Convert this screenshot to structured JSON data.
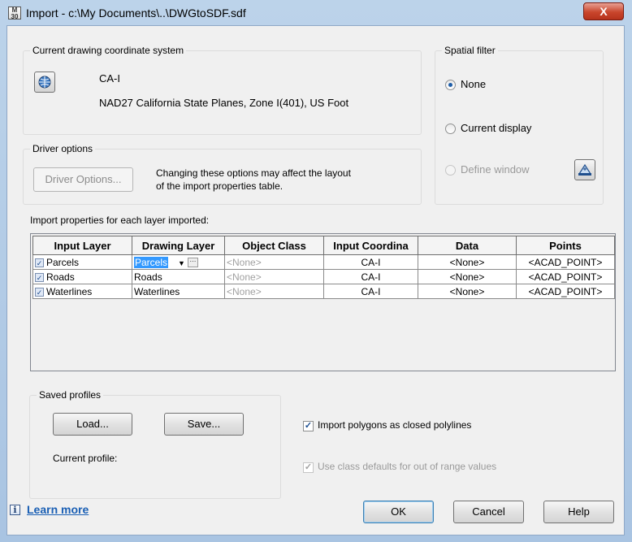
{
  "window": {
    "title": "Import - c:\\My Documents\\..\\DWGtoSDF.sdf",
    "close": "X"
  },
  "coord": {
    "legend": "Current drawing coordinate system",
    "code": "CA-I",
    "description": "NAD27 California State Planes, Zone I(401), US Foot"
  },
  "driver": {
    "legend": "Driver options",
    "button": "Driver Options...",
    "note_line1": "Changing these options may affect the layout",
    "note_line2": "of the import properties table."
  },
  "spatial": {
    "legend": "Spatial filter",
    "none": "None",
    "current_display": "Current display",
    "define_window": "Define window",
    "selected": "None"
  },
  "grid": {
    "label": "Import properties for each layer imported:",
    "headers": [
      "Input Layer",
      "Drawing Layer",
      "Object Class",
      "Input Coordina",
      "Data",
      "Points"
    ],
    "rows": [
      {
        "checked": true,
        "input_layer": "Parcels",
        "drawing_layer": "Parcels",
        "object_class": "<None>",
        "coord": "CA-I",
        "data": "<None>",
        "points": "<ACAD_POINT>"
      },
      {
        "checked": true,
        "input_layer": "Roads",
        "drawing_layer": "Roads",
        "object_class": "<None>",
        "coord": "CA-I",
        "data": "<None>",
        "points": "<ACAD_POINT>"
      },
      {
        "checked": true,
        "input_layer": "Waterlines",
        "drawing_layer": "Waterlines",
        "object_class": "<None>",
        "coord": "CA-I",
        "data": "<None>",
        "points": "<ACAD_POINT>"
      }
    ]
  },
  "profiles": {
    "legend": "Saved profiles",
    "load": "Load...",
    "save": "Save...",
    "current_label": "Current profile:"
  },
  "options": {
    "import_polygons": "Import polygons as closed polylines",
    "import_polygons_checked": true,
    "class_defaults": "Use class defaults for out of range values",
    "class_defaults_checked": true
  },
  "footer": {
    "learn_more": "Learn more",
    "info": "i",
    "ok": "OK",
    "cancel": "Cancel",
    "help": "Help"
  }
}
